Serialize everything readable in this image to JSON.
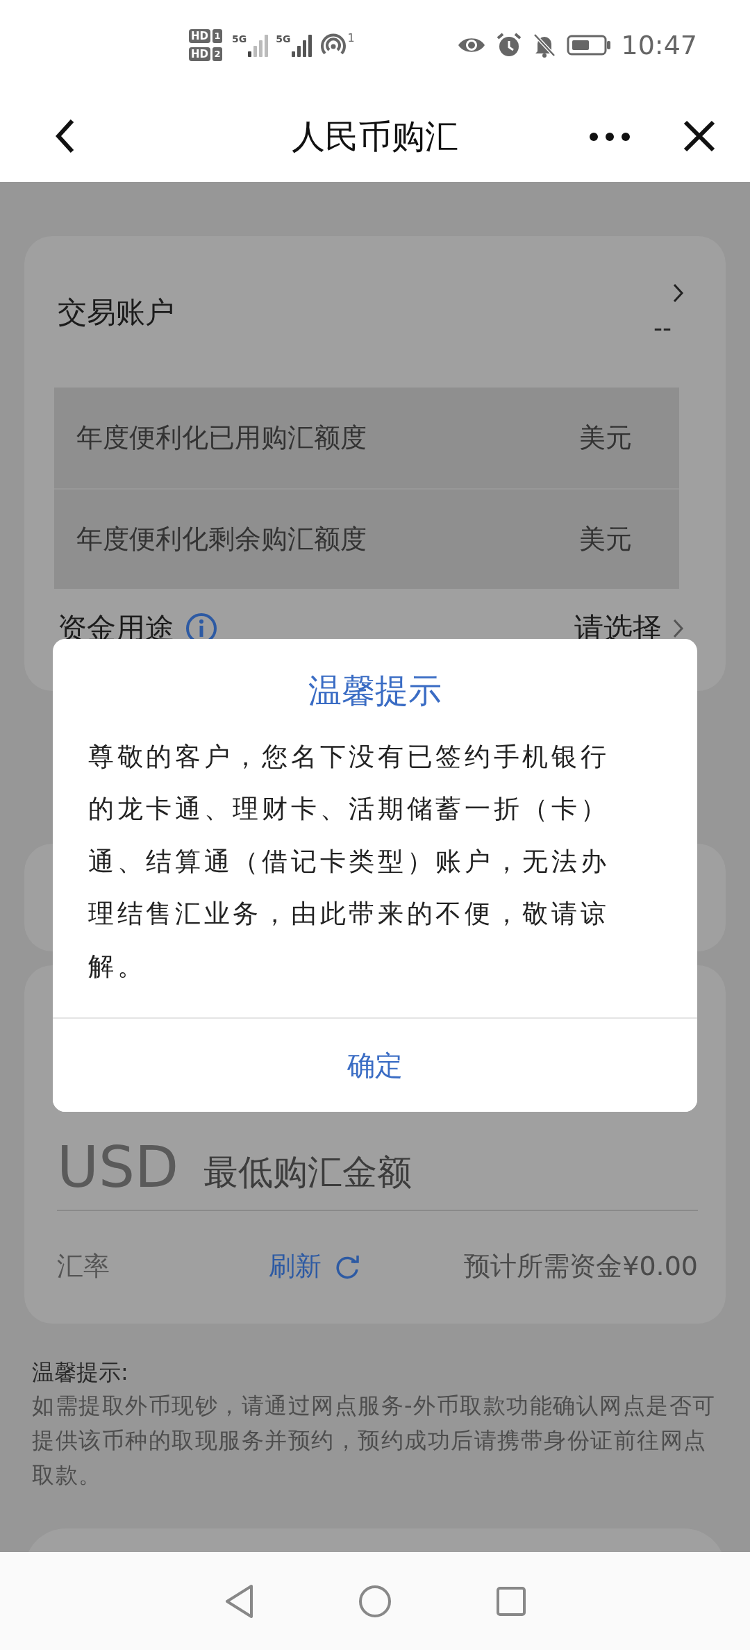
{
  "status_bar": {
    "sims": [
      {
        "badge": "HD",
        "slot": "1"
      },
      {
        "badge": "HD",
        "slot": "2"
      }
    ],
    "networks": [
      {
        "label": "5G"
      },
      {
        "label": "5G"
      }
    ],
    "hotspot_count": "1",
    "time": "10:47"
  },
  "header": {
    "title": "人民币购汇"
  },
  "account": {
    "label": "交易账户",
    "value": "--"
  },
  "quota_rows": [
    {
      "label": "年度便利化已用购汇额度",
      "unit": "美元"
    },
    {
      "label": "年度便利化剩余购汇额度",
      "unit": "美元"
    }
  ],
  "purpose": {
    "label": "资金用途",
    "value": "请选择"
  },
  "amount": {
    "currency": "USD",
    "placeholder": "最低购汇金额"
  },
  "rate": {
    "label": "汇率",
    "refresh": "刷新",
    "estimate": "预计所需资金¥0.00"
  },
  "tips": {
    "title": "温馨提示:",
    "text": "如需提取外币现钞，请通过网点服务-外币取款功能确认网点是否可提供该币种的取现服务并预约，预约成功后请携带身份证前往网点取款。"
  },
  "dialog": {
    "title": "温馨提示",
    "message": "尊敬的客户，您名下没有已签约手机银行的龙卡通、理财卡、活期储蓄一折（卡）通、结算通（借记卡类型）账户，无法办理结售汇业务，由此带来的不便，敬请谅解。",
    "confirm": "确定"
  }
}
